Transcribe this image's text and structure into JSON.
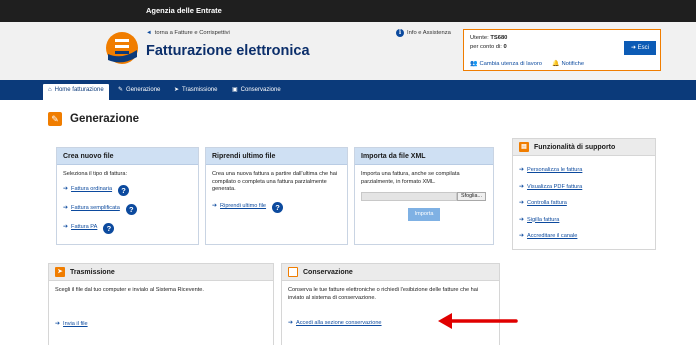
{
  "topbar": {
    "title": "Agenzia delle Entrate"
  },
  "header": {
    "back_link": "torna a Fatture e Corrispettivi",
    "app_title": "Fatturazione elettronica",
    "info_link": "Info e Assistenza"
  },
  "user": {
    "user_label": "Utente:",
    "user_value": "TS680",
    "on_behalf_label": "per conto di:",
    "on_behalf_value": "0",
    "change_user": "Cambia utenza di lavoro",
    "notifications": "Notifiche",
    "exit_label": "Esci"
  },
  "nav": {
    "items": [
      {
        "label": "Home fatturazione",
        "icon": "home-icon"
      },
      {
        "label": "Generazione",
        "icon": "pencil-icon"
      },
      {
        "label": "Trasmissione",
        "icon": "paper-plane-icon"
      },
      {
        "label": "Conservazione",
        "icon": "archive-icon"
      }
    ]
  },
  "page": {
    "title": "Generazione"
  },
  "panels": {
    "nuovo": {
      "title": "Crea nuovo file",
      "text": "Seleziona il tipo di fattura:",
      "links": [
        "Fattura ordinaria",
        "Fattura semplificata",
        "Fattura PA"
      ]
    },
    "riprendi": {
      "title": "Riprendi ultimo file",
      "text": "Crea una nuova fattura a partire dall'ultima che hai compilato o completa una fattura parzialmente generata.",
      "link": "Riprendi ultimo file"
    },
    "importa": {
      "title": "Importa da file XML",
      "text": "Importa una fattura, anche se compilata parzialmente, in formato XML.",
      "browse": "Sfoglia...",
      "import_button": "Importa"
    },
    "trasmissione": {
      "title": "Trasmissione",
      "text": "Scegli il file dal tuo computer e invialo al Sistema Ricevente.",
      "link": "Invia il file"
    },
    "conservazione": {
      "title": "Conservazione",
      "text": "Conserva le tue fatture elettroniche o richiedi l'esibizione delle fatture che hai inviato al sistema di conservazione.",
      "link": "Accedi alla sezione conservazione"
    },
    "supporto": {
      "title": "Funzionalità di supporto",
      "links": [
        "Personalizza le fattura",
        "Visualizza PDF fattura",
        "Controlla fattura",
        "Sigilla fattura",
        "Accreditare il canale"
      ]
    }
  },
  "colors": {
    "brand_dark": "#0b3a7a",
    "accent": "#f07d00",
    "link": "#0c4a9e",
    "arrow": "#e00000"
  }
}
